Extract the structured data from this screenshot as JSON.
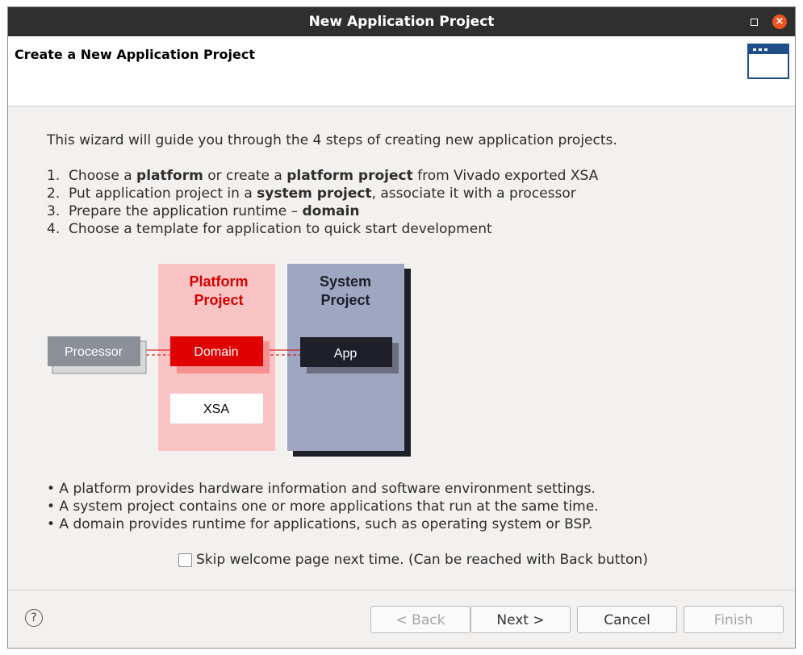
{
  "window": {
    "title": "New Application Project"
  },
  "header": {
    "title": "Create a New Application Project"
  },
  "intro": "This wizard will guide you through the 4 steps of creating new application projects.",
  "steps": [
    {
      "num": "1.",
      "parts": [
        "Choose a ",
        "platform",
        " or create a ",
        "platform project",
        " from Vivado exported XSA"
      ]
    },
    {
      "num": "2.",
      "parts": [
        "Put application project in a ",
        "system project",
        ", associate it with a processor"
      ]
    },
    {
      "num": "3.",
      "parts": [
        "Prepare the application runtime – ",
        "domain"
      ]
    },
    {
      "num": "4.",
      "parts": [
        "Choose a template for application to quick start development"
      ]
    }
  ],
  "diagram": {
    "processor": "Processor",
    "platform_line1": "Platform",
    "platform_line2": "Project",
    "domain": "Domain",
    "xsa": "XSA",
    "system_line1": "System",
    "system_line2": "Project",
    "app": "App",
    "colors": {
      "platform_bg": "#fbc4c4",
      "platform_text": "#d40000",
      "domain_bg": "#e00000",
      "system_bg": "#9ea6c1",
      "app_bg": "#1f1f2a",
      "processor_bg": "#8b8f96"
    }
  },
  "bullets": [
    "• A platform provides hardware information and software environment settings.",
    "• A system project contains one or more applications that run at the same time.",
    "• A domain provides runtime for applications, such as operating system or BSP."
  ],
  "skip_checkbox": {
    "label": "Skip welcome page next time. (Can be reached with Back button)",
    "checked": false
  },
  "footer": {
    "help_glyph": "?",
    "back": "< Back",
    "next": "Next >",
    "cancel": "Cancel",
    "finish": "Finish"
  }
}
